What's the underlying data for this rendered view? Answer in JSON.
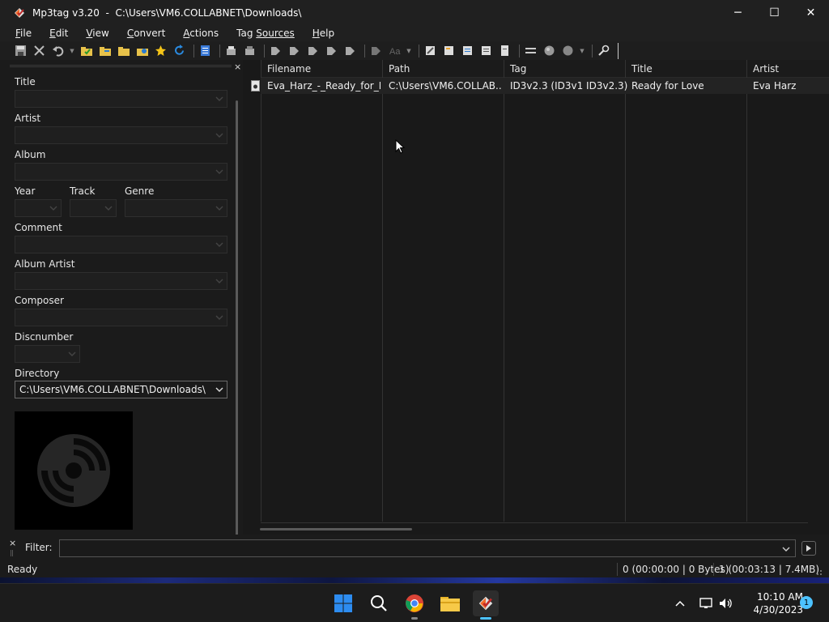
{
  "window": {
    "title": "Mp3tag v3.20  -  C:\\Users\\VM6.COLLABNET\\Downloads\\",
    "minimize": "─",
    "maximize": "☐",
    "close": "✕"
  },
  "menu": {
    "items": [
      {
        "label": "File",
        "key": "F",
        "rest": "ile"
      },
      {
        "label": "Edit",
        "key": "E",
        "rest": "dit"
      },
      {
        "label": "View",
        "key": "V",
        "rest": "iew"
      },
      {
        "label": "Convert",
        "key": "C",
        "rest": "onvert"
      },
      {
        "label": "Actions",
        "key": "A",
        "rest": "ctions"
      },
      {
        "label": "Tag Sources",
        "key": "Tag ",
        "rest": "Sources"
      },
      {
        "label": "Help",
        "key": "H",
        "rest": "elp"
      }
    ]
  },
  "tag_panel": {
    "close": "×",
    "title_label": "Title",
    "artist_label": "Artist",
    "album_label": "Album",
    "year_label": "Year",
    "track_label": "Track",
    "genre_label": "Genre",
    "comment_label": "Comment",
    "album_artist_label": "Album Artist",
    "composer_label": "Composer",
    "discnumber_label": "Discnumber",
    "directory_label": "Directory",
    "directory_value": "C:\\Users\\VM6.COLLABNET\\Downloads\\"
  },
  "file_list": {
    "columns": [
      "Filename",
      "Path",
      "Tag",
      "Title",
      "Artist"
    ],
    "rows": [
      {
        "filename": "Eva_Harz_-_Ready_for_L...",
        "path": "C:\\Users\\VM6.COLLAB...",
        "tag": "ID3v2.3 (ID3v1 ID3v2.3)",
        "title": "Ready for Love",
        "artist": "Eva Harz"
      }
    ]
  },
  "filter": {
    "close": "×",
    "label": "Filter:",
    "value": ""
  },
  "status": {
    "text": "Ready",
    "selected": "0 (00:00:00 | 0 Bytes)",
    "total": "1 (00:03:13 | 7.4MB)"
  },
  "taskbar": {
    "apps": [
      "start-icon",
      "search-icon",
      "chrome-icon",
      "file-explorer-icon",
      "mp3tag-icon"
    ],
    "time": "10:10 AM",
    "date": "4/30/2023",
    "notifications": "1"
  },
  "colors": {
    "accent": "#4cc2ff",
    "windows_blue": "#1e90ff"
  }
}
